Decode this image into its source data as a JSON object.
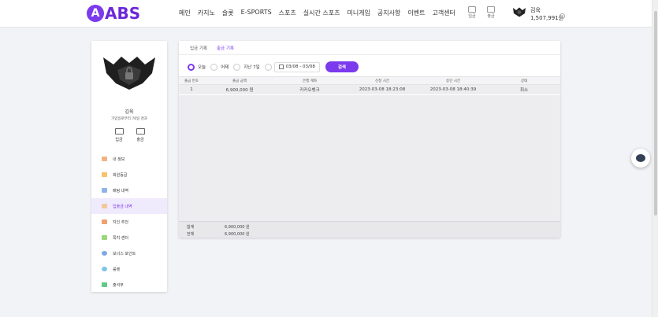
{
  "brand": {
    "logo_badge": "A",
    "logo_text": "ABS",
    "accent": "#7c3aed"
  },
  "nav": [
    "메인",
    "카지노",
    "슬롯",
    "E-SPORTS",
    "스포츠",
    "실시간 스포츠",
    "미니게임",
    "공지사항",
    "이벤트",
    "고객센터"
  ],
  "header_actions": {
    "deposit": "입금",
    "withdraw": "출금"
  },
  "user": {
    "name": "김육",
    "balance": "1,507,991원"
  },
  "sidebar": {
    "name": "김육",
    "since": "가입일로부터 76일 경과",
    "buttons": {
      "deposit": "입금",
      "withdraw": "출금"
    },
    "menu": [
      {
        "label": "내 정보",
        "icon": "user-card-icon",
        "color": "#f4b183"
      },
      {
        "label": "회원등급",
        "icon": "diamond-icon",
        "color": "#f6c26b"
      },
      {
        "label": "배팅 내역",
        "icon": "list-icon",
        "color": "#8fb4e6"
      },
      {
        "label": "입출금 내역",
        "icon": "wallet-icon",
        "color": "#f5c89b"
      },
      {
        "label": "지인 추천",
        "icon": "gift-icon",
        "color": "#f0a070"
      },
      {
        "label": "쪽지 센터",
        "icon": "message-icon",
        "color": "#9ad67a"
      },
      {
        "label": "보너스 포인트",
        "icon": "coin-icon",
        "color": "#7fa6e8"
      },
      {
        "label": "룰렛",
        "icon": "roulette-icon",
        "color": "#7ec4e8"
      },
      {
        "label": "출석부",
        "icon": "calendar-icon",
        "color": "#5fc98a"
      }
    ],
    "active_index": 3
  },
  "tabs": [
    "입금 기록",
    "출금 기록"
  ],
  "active_tab": 1,
  "filters": {
    "options": [
      "오늘",
      "어제",
      "지난 7일"
    ],
    "selected": 0,
    "date_range": "03/08 - 03/08",
    "search_label": "검색"
  },
  "table": {
    "headers": [
      "출금 번호",
      "출금 금액",
      "은행 계좌",
      "신청 시간",
      "승인 시간",
      "상태"
    ],
    "rows": [
      [
        "1",
        "6,900,000 원",
        "카카오뱅크",
        "2023-03-08 18:23:08",
        "2023-03-08 18:40:39",
        "취소"
      ]
    ]
  },
  "totals": [
    {
      "label": "합계",
      "value": "6,900,000 원"
    },
    {
      "label": "전체",
      "value": "6,900,000 원"
    }
  ]
}
